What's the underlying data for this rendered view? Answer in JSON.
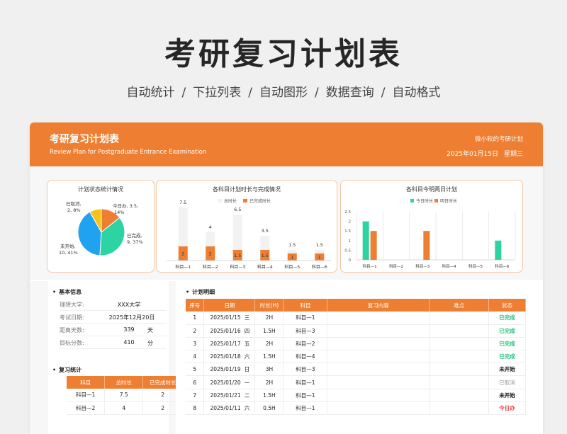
{
  "hero": {
    "title": "考研复习计划表",
    "features": [
      "自动统计",
      "下拉列表",
      "自动图形",
      "数据查询",
      "自动格式"
    ],
    "separator": "/"
  },
  "banner": {
    "title": "考研复习计划表",
    "subtitle": "Review Plan for Postgraduate Entrance Examination",
    "author": "微小软的考研计划",
    "date": "2025年01月15日",
    "weekday": "星期三"
  },
  "colors": {
    "accent": "#ee7f32",
    "teal": "#2ed3a4",
    "blue": "#1fa3f0",
    "yellow": "#f7c31a",
    "done": "#2ec27e",
    "today": "#e8423f"
  },
  "pie_panel": {
    "title": "计划状态统计情况",
    "labels": [
      {
        "name": "今日办",
        "line2": "3, 5, 14%",
        "full": "今日办, 3.5,"
      },
      {
        "name": "已完成",
        "full": "已完成,"
      },
      {
        "name": "未开始",
        "full": "未开始,"
      },
      {
        "name": "已取消",
        "full": "已取消,"
      }
    ],
    "label_text": {
      "today_1": "今日办, 3.5,",
      "today_2": "14%",
      "done_1": "已完成,",
      "done_2": "9, 37%",
      "todo_1": "未开始,",
      "todo_2": "10, 41%",
      "cancel_1": "已取消,",
      "cancel_2": "2, 8%"
    }
  },
  "chart_data": [
    {
      "type": "pie",
      "title": "计划状态统计情况",
      "categories": [
        "今日办",
        "已完成",
        "未开始",
        "已取消"
      ],
      "values": [
        3.5,
        9,
        10,
        2
      ],
      "percents": [
        14,
        37,
        41,
        8
      ],
      "colors": [
        "#ee7f32",
        "#2ed3a4",
        "#1fa3f0",
        "#f7c31a"
      ]
    },
    {
      "type": "bar",
      "title": "各科目计划时长与完成情况",
      "categories": [
        "科目—1",
        "科目—2",
        "科目—3",
        "科目—4",
        "科目—5",
        "科目—6"
      ],
      "series": [
        {
          "name": "总时长",
          "values": [
            7.5,
            4,
            6.5,
            3.5,
            1.5,
            1.5
          ]
        },
        {
          "name": "已完成时长",
          "values": [
            2,
            2,
            1.5,
            1.5,
            1,
            1
          ]
        }
      ],
      "legend": "top"
    },
    {
      "type": "bar",
      "title": "各科目今明两日计划",
      "categories": [
        "科目—1",
        "科目—2",
        "科目—3",
        "科目—4",
        "科目—5",
        "科目—6"
      ],
      "series": [
        {
          "name": "今日时长",
          "values": [
            2,
            0,
            0,
            0,
            0,
            1
          ]
        },
        {
          "name": "明日时长",
          "values": [
            1.5,
            0,
            1.5,
            0,
            0,
            0
          ]
        }
      ],
      "ylim": [
        0,
        2.5
      ],
      "yticks": [
        "0",
        "0.5",
        "1",
        "1.5",
        "2",
        "2.5"
      ],
      "legend": "top",
      "grid": true
    }
  ],
  "basic_info": {
    "title": "基本信息",
    "rows": [
      {
        "key": "理想大学:",
        "value": "XXX大学",
        "unit": ""
      },
      {
        "key": "考试日期:",
        "value": "2025年12月20日",
        "unit": ""
      },
      {
        "key": "距离天数:",
        "value": "339",
        "unit": "天"
      },
      {
        "key": "目标分数:",
        "value": "410",
        "unit": "分"
      }
    ]
  },
  "review_stats": {
    "title": "复习统计",
    "headers": [
      "科目",
      "总时长",
      "已完成时长"
    ],
    "rows": [
      [
        "科目—1",
        "7.5",
        "2"
      ],
      [
        "科目—2",
        "4",
        "2"
      ]
    ]
  },
  "plan": {
    "title": "计划明细",
    "headers": [
      "序号",
      "日期",
      "时长(H)",
      "科目",
      "复习内容",
      "难点",
      "状态"
    ],
    "rows": [
      {
        "no": "1",
        "date": "2025/01/15",
        "wd": "三",
        "hours": "2H",
        "subject": "科目—1",
        "content": "",
        "hard": "",
        "status": "已完成",
        "cls": "st-done"
      },
      {
        "no": "2",
        "date": "2025/01/16",
        "wd": "四",
        "hours": "1.5H",
        "subject": "科目—3",
        "content": "",
        "hard": "",
        "status": "已完成",
        "cls": "st-done"
      },
      {
        "no": "3",
        "date": "2025/01/17",
        "wd": "五",
        "hours": "2H",
        "subject": "科目—2",
        "content": "",
        "hard": "",
        "status": "已完成",
        "cls": "st-done"
      },
      {
        "no": "4",
        "date": "2025/01/18",
        "wd": "六",
        "hours": "1.5H",
        "subject": "科目—4",
        "content": "",
        "hard": "",
        "status": "已完成",
        "cls": "st-done"
      },
      {
        "no": "5",
        "date": "2025/01/19",
        "wd": "日",
        "hours": "3H",
        "subject": "科目—3",
        "content": "",
        "hard": "",
        "status": "未开始",
        "cls": "st-todo"
      },
      {
        "no": "6",
        "date": "2025/01/20",
        "wd": "一",
        "hours": "2H",
        "subject": "科目—1",
        "content": "",
        "hard": "",
        "status": "已取消",
        "cls": "st-cancel"
      },
      {
        "no": "7",
        "date": "2025/01/21",
        "wd": "二",
        "hours": "1.5H",
        "subject": "科目—1",
        "content": "",
        "hard": "",
        "status": "未开始",
        "cls": "st-todo"
      },
      {
        "no": "8",
        "date": "2025/01/11",
        "wd": "六",
        "hours": "0.5H",
        "subject": "科目—1",
        "content": "",
        "hard": "",
        "status": "今日办",
        "cls": "st-today"
      }
    ]
  }
}
